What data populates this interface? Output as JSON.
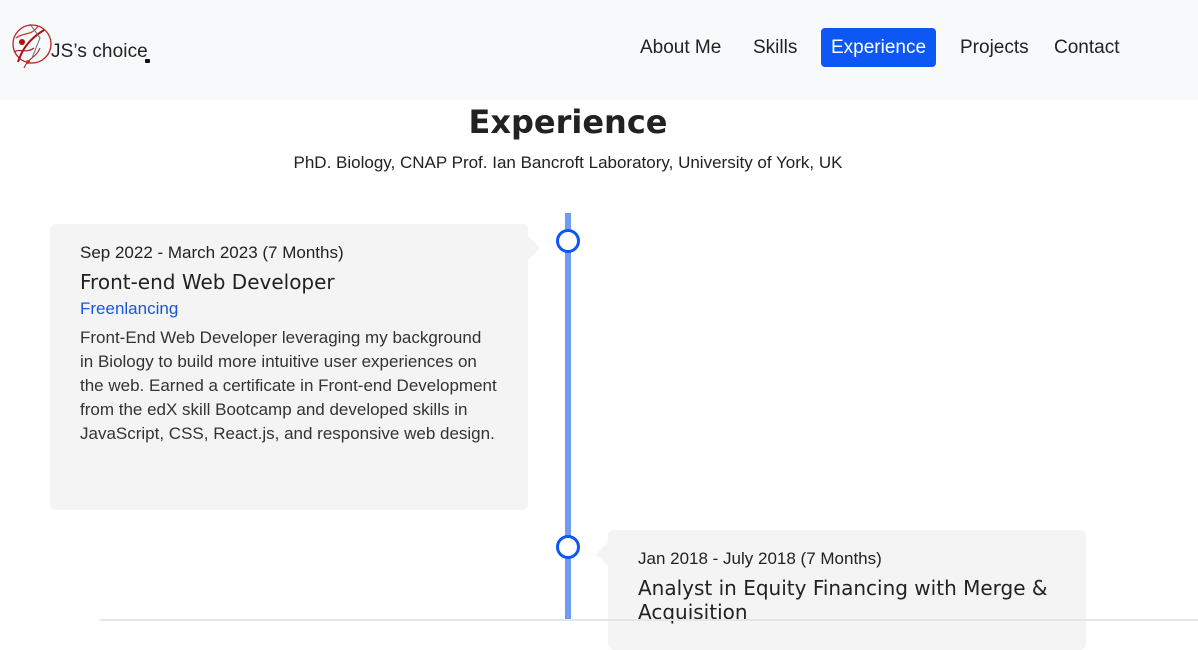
{
  "header": {
    "logo_text": "JS’s choice",
    "nav": [
      {
        "label": "About Me",
        "active": false
      },
      {
        "label": "Skills",
        "active": false
      },
      {
        "label": "Experience",
        "active": true
      },
      {
        "label": "Projects",
        "active": false
      },
      {
        "label": "Contact",
        "active": false
      }
    ]
  },
  "experience": {
    "title": "Experience",
    "subtitle": "PhD. Biology, CNAP Prof. Ian Bancroft Laboratory, University of York, UK",
    "items": [
      {
        "date": "Sep 2022 - March 2023 (7 Months)",
        "role": "Front-end Web Developer",
        "org": "Freenlancing",
        "description": "Front-End Web Developer leveraging my background in Biology to build more intuitive user experiences on the web. Earned a certificate in Front-end Development from the edX skill Bootcamp and developed skills in JavaScript, CSS, React.js, and responsive web design."
      },
      {
        "date": "Jan 2018 - July 2018 (7 Months)",
        "role": "Analyst in Equity Financing with Merge & Acquisition"
      }
    ]
  },
  "colors": {
    "accent": "#0d57f5",
    "timeline": "#6f9cf2",
    "card_bg": "#f4f4f4",
    "link": "#1a56db"
  }
}
